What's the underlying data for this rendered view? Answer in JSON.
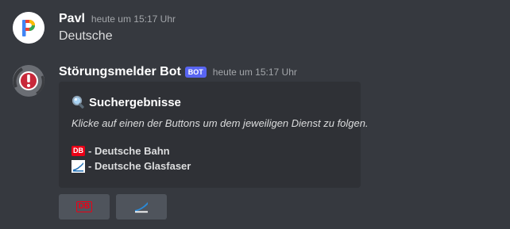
{
  "messages": [
    {
      "author": "Pavl",
      "timestamp": "heute um 15:17 Uhr",
      "content": "Deutsche",
      "avatar_icon": "pavl-p-logo-icon"
    },
    {
      "author": "Störungsmelder Bot",
      "bot_tag": "BOT",
      "timestamp": "heute um 15:17 Uhr",
      "avatar_icon": "warning-exclamation-icon",
      "embed": {
        "title_icon": "magnifying-glass-icon",
        "title": "Suchergebnisse",
        "description": "Klicke auf einen der Buttons um dem jeweiligen Dienst zu folgen.",
        "services": [
          {
            "icon": "db-logo-icon",
            "icon_text": "DB",
            "label": "- Deutsche Bahn"
          },
          {
            "icon": "glasfaser-logo-icon",
            "label": "- Deutsche Glasfaser"
          }
        ]
      },
      "buttons": [
        {
          "icon": "db-logo-icon",
          "icon_text": "DB"
        },
        {
          "icon": "glasfaser-logo-icon"
        }
      ]
    }
  ],
  "colors": {
    "background": "#36393f",
    "embed_background": "#2f3136",
    "button_background": "#4f545c",
    "bot_tag": "#5865f2",
    "db_red": "#ec0016",
    "glasfaser_blue": "#1f6fb5"
  }
}
